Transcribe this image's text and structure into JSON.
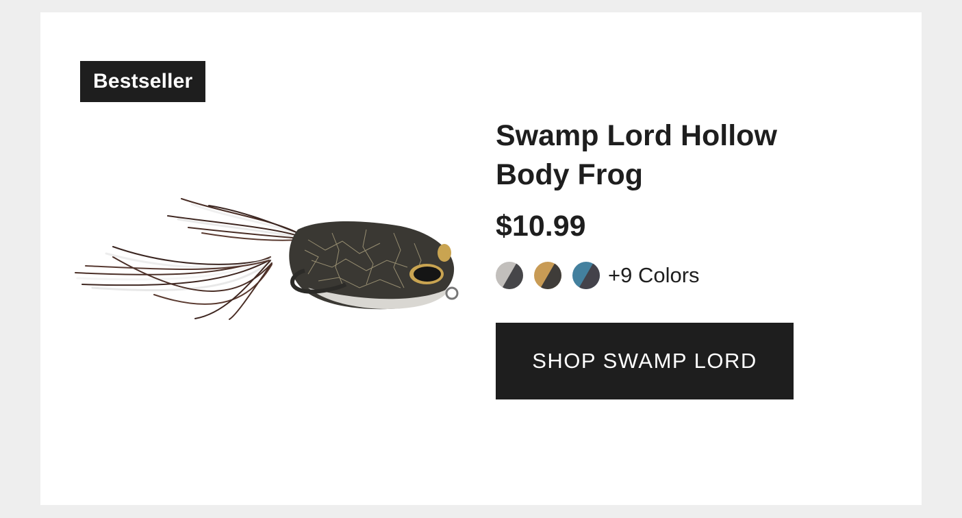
{
  "badge": {
    "label": "Bestseller"
  },
  "product": {
    "title": "Swamp Lord Hollow Body Frog",
    "price": "$10.99",
    "image_icon": "frog-lure-image",
    "colors": {
      "swatches": [
        {
          "name": "gray",
          "top": "#c2bfbc",
          "bottom": "#464649"
        },
        {
          "name": "tan",
          "top": "#c89b55",
          "bottom": "#3f3c39"
        },
        {
          "name": "blue",
          "top": "#43809e",
          "bottom": "#43424a"
        }
      ],
      "more_label": "+9 Colors"
    },
    "cta_label": "SHOP SWAMP LORD"
  },
  "colors": {
    "background": "#eeeeee",
    "card": "#ffffff",
    "dark": "#1e1e1e"
  }
}
